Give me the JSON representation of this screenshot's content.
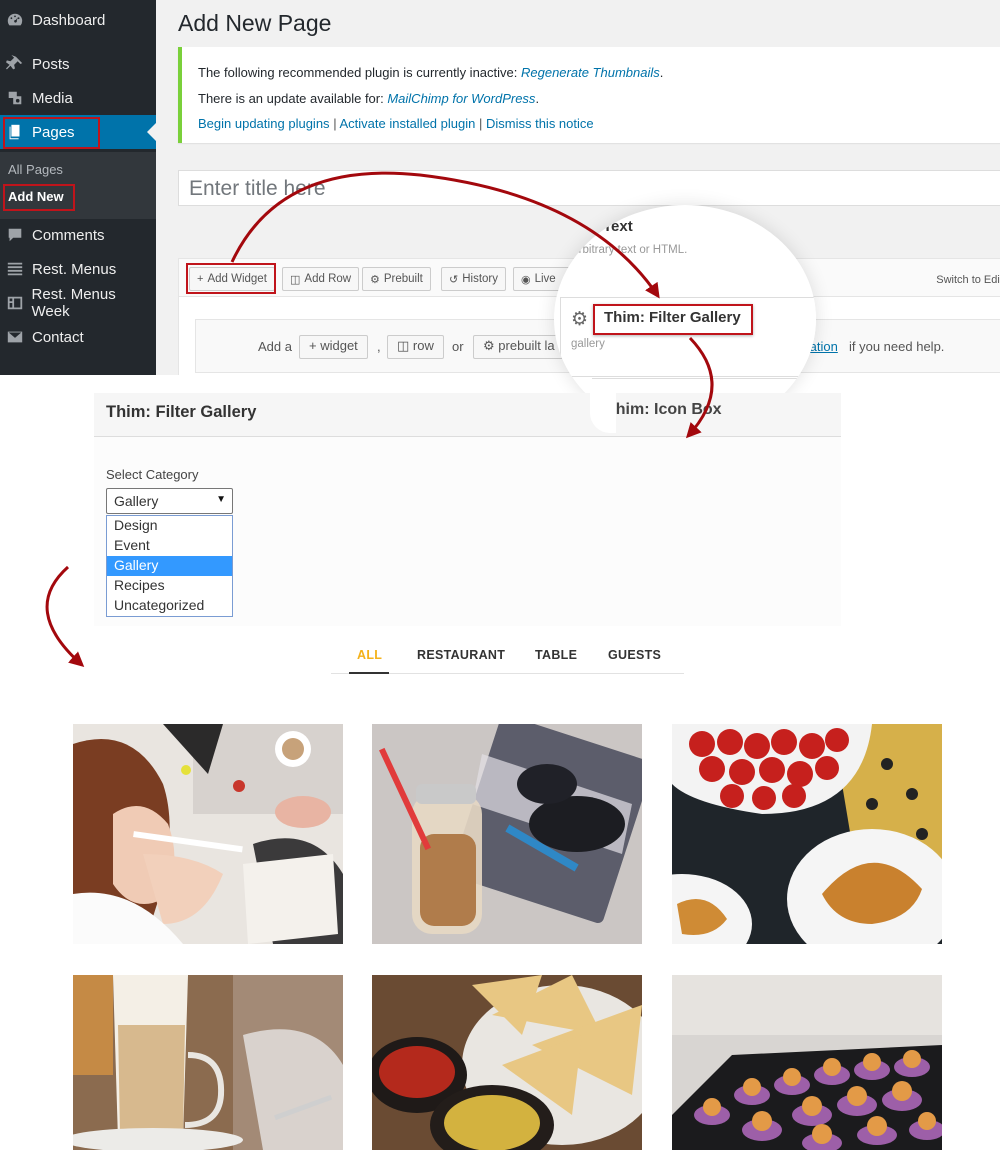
{
  "sidebar": {
    "items": [
      {
        "label": "Dashboard",
        "icon": "dashboard-icon"
      },
      {
        "label": "Posts",
        "icon": "pin-icon"
      },
      {
        "label": "Media",
        "icon": "media-icon"
      },
      {
        "label": "Pages",
        "icon": "pages-icon"
      },
      {
        "label": "Comments",
        "icon": "comment-icon"
      },
      {
        "label": "Rest. Menus",
        "icon": "list-icon"
      },
      {
        "label": "Rest. Menus Week",
        "icon": "film-icon"
      },
      {
        "label": "Contact",
        "icon": "mail-icon"
      }
    ],
    "submenu": [
      "All Pages",
      "Add New"
    ]
  },
  "page": {
    "title": "Add New Page",
    "title_placeholder": "Enter title here"
  },
  "notice": {
    "line1_prefix": "The following recommended plugin is currently inactive: ",
    "line1_plugin": "Regenerate Thumbnails",
    "line1_suffix": ".",
    "line2_prefix": "There is an update available for: ",
    "line2_plugin": "MailChimp for WordPress",
    "line2_suffix": ".",
    "link_update": "Begin updating plugins",
    "link_activate": "Activate installed plugin",
    "link_dismiss": "Dismiss this notice",
    "separator": "|",
    "accent_color": "#7ad03a"
  },
  "builder": {
    "toolbar": {
      "add_widget": "Add Widget",
      "add_row": "Add Row",
      "prebuilt": "Prebuilt",
      "history": "History",
      "live": "Live",
      "switch_editor": "Switch to Edito"
    },
    "empty": {
      "add_a": "Add a",
      "widget_btn": "widget",
      "comma": ",",
      "row_btn": "row",
      "or": "or",
      "prebuilt_btn": "prebuilt la",
      "doc_link": "tation",
      "help_suffix": "if you need help."
    }
  },
  "magnifier": {
    "text_title": "Text",
    "text_desc": "Arbitrary text or HTML.",
    "filter_title": "Thim: Filter Gallery",
    "filter_desc": "gallery",
    "icon_box": "Thim: Icon Box"
  },
  "widget_form": {
    "header": "Thim: Filter Gallery",
    "header_ghost": "Thim: Icon Box",
    "select_label": "Select Category",
    "selected": "Gallery",
    "options": [
      "Design",
      "Event",
      "Gallery",
      "Recipes",
      "Uncategorized"
    ],
    "highlight_color": "#3399ff"
  },
  "filter": {
    "tabs": [
      "ALL",
      "RESTAURANT",
      "TABLE",
      "GUESTS"
    ],
    "active_color": "#f4b21b"
  },
  "gallery": {
    "photos": [
      "woman-writing-photo",
      "drink-bottle-photo",
      "strawberries-croissants-photo",
      "latte-glass-photo",
      "nachos-dips-photo",
      "pastries-photo"
    ]
  },
  "colors": {
    "wp_sidebar": "#23282d",
    "wp_active": "#0073aa",
    "annotation_red": "#c0141b",
    "arrow_red": "#a3080d"
  }
}
